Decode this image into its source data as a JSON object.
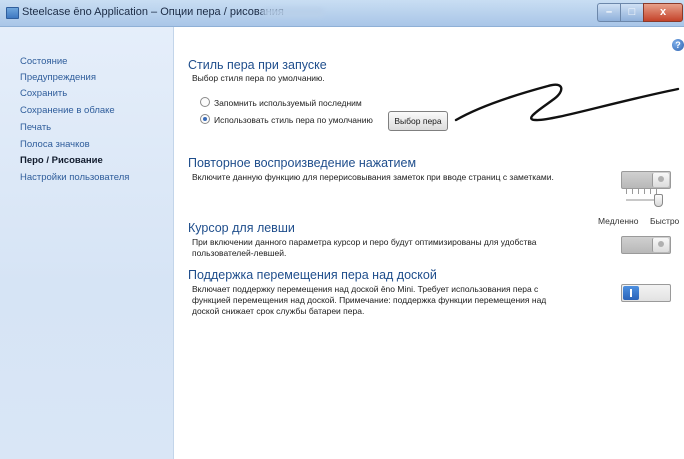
{
  "window": {
    "title": "Steelcase ēno Application – Опции пера / рисования",
    "buttons": {
      "minimize": "–",
      "maximize": "□",
      "close": "x"
    }
  },
  "sidebar": {
    "items": [
      {
        "label": "Состояние",
        "selected": false
      },
      {
        "label": "Предупреждения",
        "selected": false
      },
      {
        "label": "Сохранить",
        "selected": false
      },
      {
        "label": "Сохранение в облаке",
        "selected": false
      },
      {
        "label": "Печать",
        "selected": false
      },
      {
        "label": "Полоса значков",
        "selected": false
      },
      {
        "label": "Перо / Рисование",
        "selected": true
      },
      {
        "label": "Настройки пользователя",
        "selected": false
      }
    ]
  },
  "content": {
    "help_icon": "?",
    "pen_style": {
      "title": "Стиль пера при запуске",
      "description": "Выбор стиля пера по умолчанию.",
      "options": [
        {
          "label": "Запомнить используемый последним",
          "checked": false
        },
        {
          "label": "Использовать стиль пера по умолчанию",
          "checked": true
        }
      ],
      "select_button": "Выбор пера"
    },
    "replay": {
      "title": "Повторное воспроизведение нажатием",
      "description": "Включите данную функцию для перерисовывания заметок при вводе страниц с заметками.",
      "toggle_on": false,
      "speed_slow": "Медленно",
      "speed_fast": "Быстро",
      "speed_level": 1.0
    },
    "left_hand": {
      "title": "Курсор для левши",
      "description": "При включении данного параметра курсор и перо будут оптимизированы для удобства пользователей-левшей.",
      "toggle_on": false
    },
    "hover": {
      "title": "Поддержка перемещения пера над доской",
      "description": "Включает поддержку перемещения над доской ēno Mini. Требует использования пера с функцией перемещения над доской. Примечание: поддержка функции перемещения над доской снижает срок службы батареи пера.",
      "toggle_on": true
    }
  },
  "colors": {
    "accent": "#1f4e8c",
    "sidebar_link": "#2f5d9b",
    "toggle_on": "#2a63b8"
  }
}
